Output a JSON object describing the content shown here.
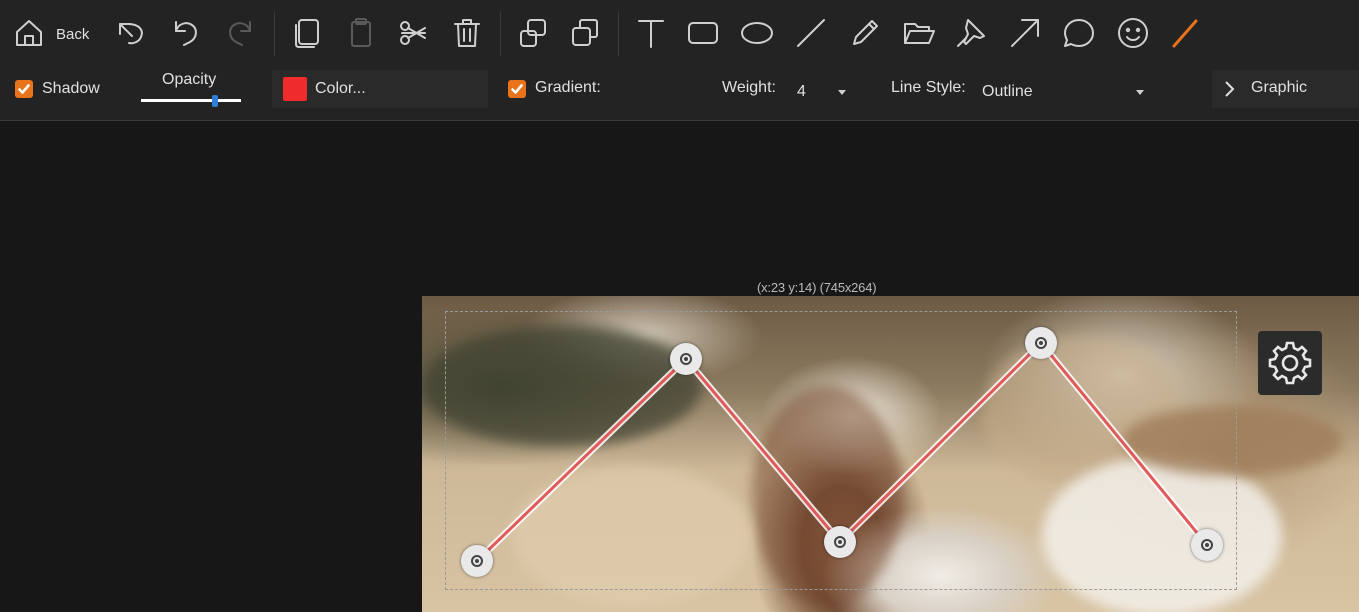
{
  "toolbar": {
    "back_label": "Back",
    "tools": [
      {
        "name": "undo-all-icon"
      },
      {
        "name": "undo-icon"
      },
      {
        "name": "redo-icon",
        "disabled": true
      },
      {
        "name": "copy-icon"
      },
      {
        "name": "paste-icon",
        "disabled": true
      },
      {
        "name": "cut-icon"
      },
      {
        "name": "delete-icon"
      },
      {
        "name": "bring-forward-icon"
      },
      {
        "name": "send-backward-icon"
      },
      {
        "name": "text-tool-icon"
      },
      {
        "name": "rectangle-tool-icon"
      },
      {
        "name": "ellipse-tool-icon"
      },
      {
        "name": "line-tool-icon"
      },
      {
        "name": "pencil-tool-icon"
      },
      {
        "name": "open-folder-icon"
      },
      {
        "name": "pin-tool-icon"
      },
      {
        "name": "arrow-tool-icon"
      },
      {
        "name": "speech-bubble-tool-icon"
      },
      {
        "name": "smiley-tool-icon"
      },
      {
        "name": "polyline-tool-icon",
        "active": true
      }
    ]
  },
  "options": {
    "shadow_label": "Shadow",
    "shadow_checked": true,
    "opacity_label": "Opacity",
    "opacity_value": 0.74,
    "color_label": "Color...",
    "color_value": "#f02b2b",
    "gradient_label": "Gradient:",
    "gradient_checked": true,
    "weight_label": "Weight:",
    "weight_value": "4",
    "line_style_label": "Line Style:",
    "line_style_value": "Outline",
    "graphic_label": "Graphic"
  },
  "canvas": {
    "selection_info": "(x:23 y:14) (745x264)",
    "line_color": "#e05a5a",
    "accent": "#e8731a"
  }
}
